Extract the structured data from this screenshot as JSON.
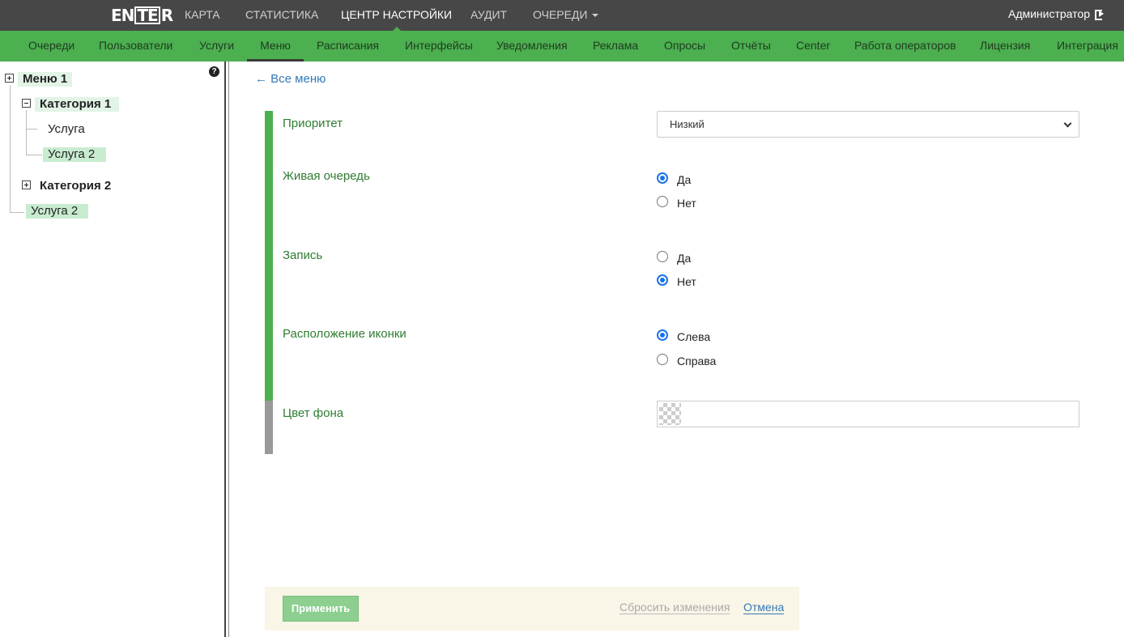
{
  "header": {
    "logo_parts": [
      "EN",
      "TE",
      "R"
    ],
    "nav": [
      {
        "label": "КАРТА",
        "active": false
      },
      {
        "label": "СТАТИСТИКА",
        "active": false
      },
      {
        "label": "ЦЕНТР НАСТРОЙКИ",
        "active": true
      },
      {
        "label": "АУДИТ",
        "active": false
      },
      {
        "label": "ОЧЕРЕДИ",
        "active": false,
        "dropdown": true
      }
    ],
    "user": "Администратор",
    "logout_icon": "logout-icon"
  },
  "subnav": [
    {
      "label": "Очереди",
      "active": false
    },
    {
      "label": "Пользователи",
      "active": false
    },
    {
      "label": "Услуги",
      "active": false
    },
    {
      "label": "Меню",
      "active": true
    },
    {
      "label": "Расписания",
      "active": false
    },
    {
      "label": "Интерфейсы",
      "active": false
    },
    {
      "label": "Уведомления",
      "active": false
    },
    {
      "label": "Реклама",
      "active": false
    },
    {
      "label": "Опросы",
      "active": false
    },
    {
      "label": "Отчёты",
      "active": false
    },
    {
      "label": "Center",
      "active": false
    },
    {
      "label": "Работа операторов",
      "active": false
    },
    {
      "label": "Лицензия",
      "active": false
    },
    {
      "label": "Интеграция",
      "active": false
    }
  ],
  "tree": {
    "help_icon": "question-circle-icon",
    "nodes": [
      {
        "label": "Меню 1",
        "bold": true,
        "expanded": false
      },
      {
        "label": "Категория 1",
        "bold": true,
        "expanded": true
      },
      {
        "label": "Услуга",
        "bold": false
      },
      {
        "label": "Услуга 2",
        "bold": false,
        "selected": true
      },
      {
        "label": "Категория 2",
        "bold": true,
        "expanded": false
      },
      {
        "label": "Услуга 2",
        "bold": false,
        "selected": true
      }
    ]
  },
  "main": {
    "back_link": "← Все меню",
    "fields": {
      "priority": {
        "label": "Приоритет",
        "value": "Низкий"
      },
      "live_queue": {
        "label": "Живая очередь",
        "options": [
          "Да",
          "Нет"
        ],
        "selected": "Да"
      },
      "booking": {
        "label": "Запись",
        "options": [
          "Да",
          "Нет"
        ],
        "selected": "Нет"
      },
      "icon_position": {
        "label": "Расположение иконки",
        "options": [
          "Слева",
          "Справа"
        ],
        "selected": "Слева"
      },
      "bg_color": {
        "label": "Цвет фона",
        "value": ""
      }
    },
    "actions": {
      "apply": "Применить",
      "reset": "Сбросить изменения",
      "cancel": "Отмена"
    }
  },
  "colors": {
    "topbar": "#474747",
    "accent_green": "#4caf50",
    "label_green": "#2e7d32",
    "link_blue": "#337ab7",
    "radio_blue": "#1a73e8"
  }
}
